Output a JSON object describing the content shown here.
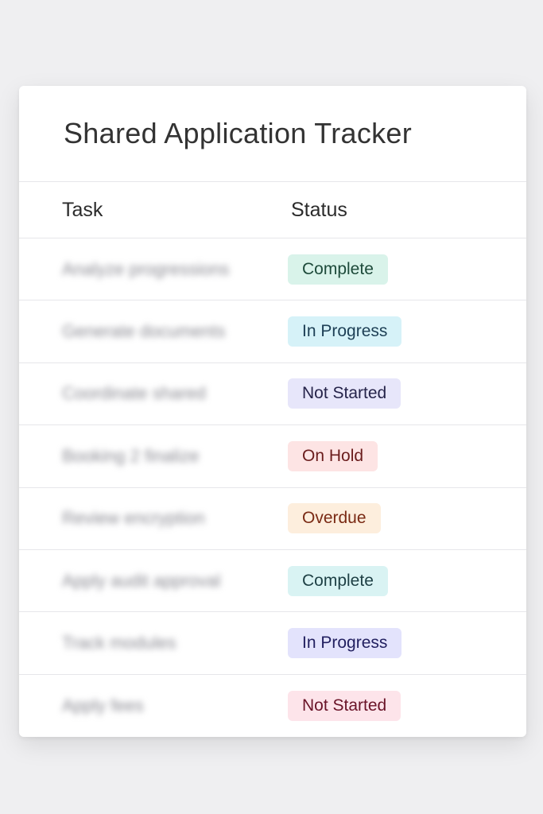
{
  "tracker": {
    "title": "Shared Application Tracker",
    "columns": {
      "task": "Task",
      "status": "Status"
    },
    "rows": [
      {
        "task": "Analyze progressions",
        "status": "Complete",
        "bg": "#d9f3ea",
        "fg": "#1d4a3a"
      },
      {
        "task": "Generate documents",
        "status": "In Progress",
        "bg": "#d6f2f8",
        "fg": "#1d3f55"
      },
      {
        "task": "Coordinate shared",
        "status": "Not Started",
        "bg": "#e7e6fa",
        "fg": "#26244a"
      },
      {
        "task": "Booking 2 finalize",
        "status": "On Hold",
        "bg": "#fde4e4",
        "fg": "#6a1c1c"
      },
      {
        "task": "Review encryption",
        "status": "Overdue",
        "bg": "#fdeedd",
        "fg": "#7a2a14"
      },
      {
        "task": "Apply audit approval",
        "status": "Complete",
        "bg": "#d9f3f3",
        "fg": "#1d3f44"
      },
      {
        "task": "Track modules",
        "status": "In Progress",
        "bg": "#e3e3fc",
        "fg": "#222060"
      },
      {
        "task": "Apply fees",
        "status": "Not Started",
        "bg": "#fde4ea",
        "fg": "#6a1428"
      }
    ]
  }
}
